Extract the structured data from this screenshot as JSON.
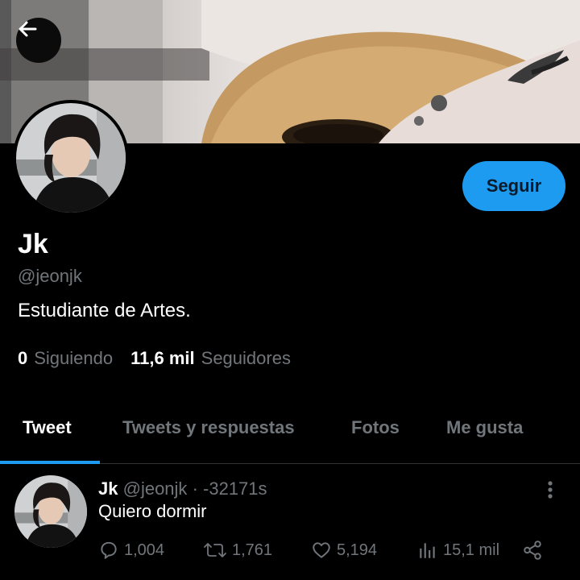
{
  "profile": {
    "name": "Jk",
    "handle": "@jeonjk",
    "bio": "Estudiante de Artes.",
    "follow_label": "Seguir",
    "following_count": "0",
    "following_label": "Siguiendo",
    "followers_count": "11,6 mil",
    "followers_label": "Seguidores"
  },
  "tabs": [
    {
      "label": "Tweet",
      "active": true
    },
    {
      "label": "Tweets y respuestas",
      "active": false
    },
    {
      "label": "Fotos",
      "active": false
    },
    {
      "label": "Me gusta",
      "active": false
    }
  ],
  "tweet": {
    "name": "Jk",
    "handle": "@jeonjk",
    "separator": "·",
    "time": "-32171s",
    "text": "Quiero dormir",
    "replies": "1,004",
    "retweets": "1,761",
    "likes": "5,194",
    "views": "15,1 mil"
  },
  "colors": {
    "accent": "#1d9bf0",
    "background": "#000000",
    "muted": "#71767b"
  },
  "icons": [
    "back-arrow-icon",
    "more-vertical-icon",
    "reply-icon",
    "retweet-icon",
    "like-icon",
    "views-icon",
    "share-icon"
  ]
}
